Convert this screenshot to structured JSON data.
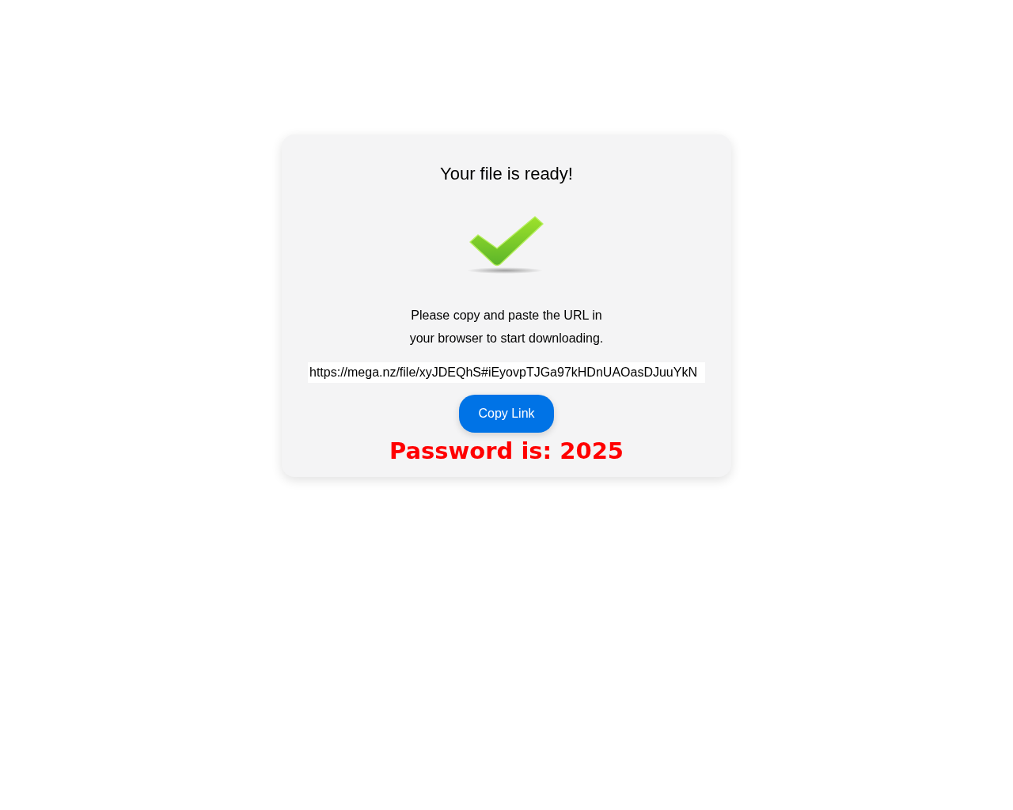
{
  "card": {
    "title": "Your file is ready!",
    "instructions": "Please copy and paste the URL in your browser to start downloading.",
    "url_field": {
      "value": "https://mega.nz/file/xyJDEQhS#iEyovpTJGa97kHDnUAOasDJuuYkN"
    },
    "copy_button": "Copy Link",
    "password_note": "Password is: 2025"
  }
}
